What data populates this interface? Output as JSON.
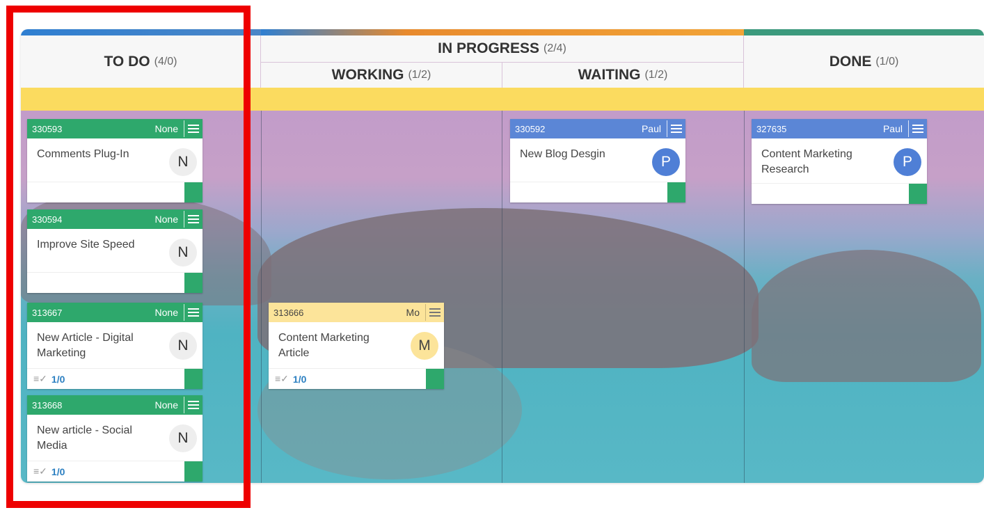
{
  "columns": {
    "todo": {
      "title": "TO DO",
      "count": "(4/0)"
    },
    "in_progress": {
      "title": "IN PROGRESS",
      "count": "(2/4)"
    },
    "working": {
      "title": "WORKING",
      "count": "(1/2)"
    },
    "waiting": {
      "title": "WAITING",
      "count": "(1/2)"
    },
    "done": {
      "title": "DONE",
      "count": "(1/0)"
    }
  },
  "cards": {
    "c330593": {
      "id": "330593",
      "owner": "None",
      "title": "Comments Plug-In",
      "avatar": "N"
    },
    "c330594": {
      "id": "330594",
      "owner": "None",
      "title": "Improve Site Speed",
      "avatar": "N"
    },
    "c313667": {
      "id": "313667",
      "owner": "None",
      "title": "New Article - Digital Marketing",
      "avatar": "N",
      "checklist": "1/0"
    },
    "c313668": {
      "id": "313668",
      "owner": "None",
      "title": "New article - Social Media",
      "avatar": "N",
      "checklist": "1/0"
    },
    "c313666": {
      "id": "313666",
      "owner": "Mo",
      "title": "Content Marketing Article",
      "avatar": "M",
      "checklist": "1/0"
    },
    "c330592": {
      "id": "330592",
      "owner": "Paul",
      "title": "New Blog Desgin",
      "avatar": "P"
    },
    "c327635": {
      "id": "327635",
      "owner": "Paul",
      "title": "Content Marketing Research",
      "avatar": "P"
    }
  },
  "colors": {
    "green_header": "#2ea86c",
    "blue_header": "#5b86d6",
    "yellow_header": "#fce49a",
    "swimlane_yellow": "#fbdb5f",
    "highlight_red": "#ee0000"
  }
}
